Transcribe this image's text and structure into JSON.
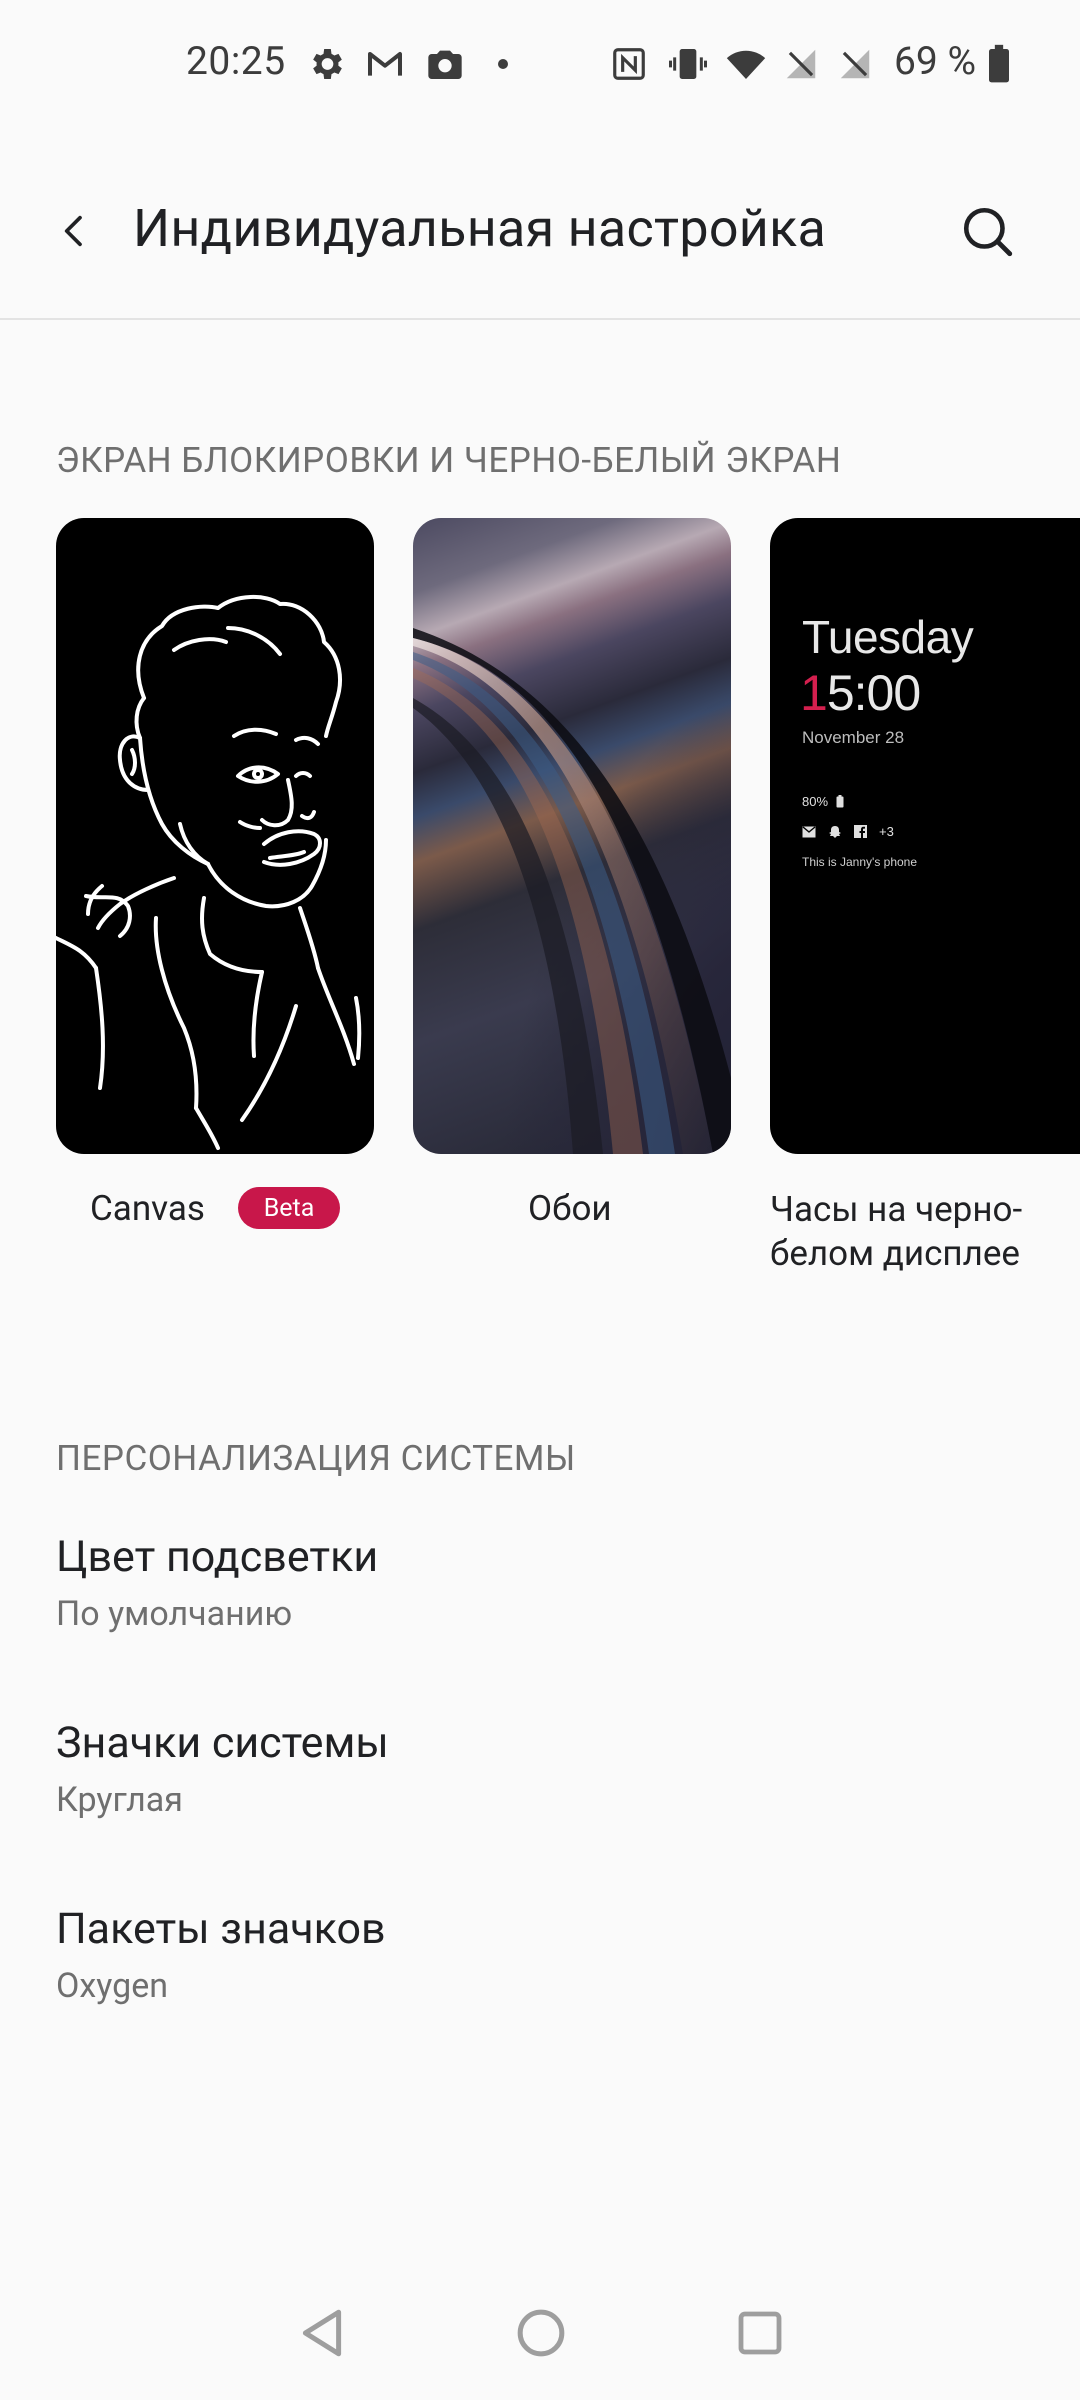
{
  "status_bar": {
    "time": "20:25",
    "battery_percent": "69 %",
    "left_icons": [
      "gear-icon",
      "gmail-icon",
      "camera-icon",
      "dot-icon"
    ],
    "right_icons": [
      "nfc-icon",
      "vibrate-icon",
      "wifi-icon",
      "no-sim-icon",
      "no-sim-icon",
      "battery-icon"
    ]
  },
  "app_bar": {
    "title": "Индивидуальная настройка"
  },
  "lock_screen_section": {
    "title": "ЭКРАН БЛОКИРОВКИ И ЧЕРНО-БЕЛЫЙ ЭКРАН",
    "cards": [
      {
        "label": "Canvas",
        "badge": "Beta"
      },
      {
        "label": "Обои"
      },
      {
        "label": "Часы на черно-белом дисплее",
        "preview": {
          "day": "Tuesday",
          "time_accent": "1",
          "time_rest": "5:00",
          "date": "November 28",
          "battery": "80%",
          "extra_count": "+3",
          "owner": "This is Janny's phone"
        }
      }
    ]
  },
  "system_section": {
    "title": "ПЕРСОНАЛИЗАЦИЯ СИСТЕМЫ",
    "items": [
      {
        "title": "Цвет подсветки",
        "summary": "По умолчанию"
      },
      {
        "title": "Значки системы",
        "summary": "Круглая"
      },
      {
        "title": "Пакеты значков",
        "summary": "Oxygen"
      }
    ]
  },
  "colors": {
    "accent": "#c8174a",
    "background": "#fafafa",
    "aod_accent": "#d41f4e"
  }
}
